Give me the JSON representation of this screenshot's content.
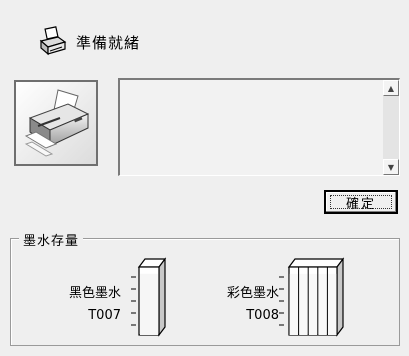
{
  "status": {
    "text": "準備就緒",
    "icon": "printer-icon"
  },
  "message": {
    "text": ""
  },
  "ok_button": {
    "label": "確定"
  },
  "ink_levels": {
    "group_title": "墨水存量",
    "black": {
      "name": "黑色墨水",
      "cartridge": "T007",
      "level": 0.9,
      "color": "#000000"
    },
    "color": {
      "name": "彩色墨水",
      "cartridge": "T008",
      "channels": 5,
      "level": 0.9
    }
  },
  "colors": {
    "dialog_bg": "#efefef",
    "border_dark": "#7a7a7a"
  }
}
